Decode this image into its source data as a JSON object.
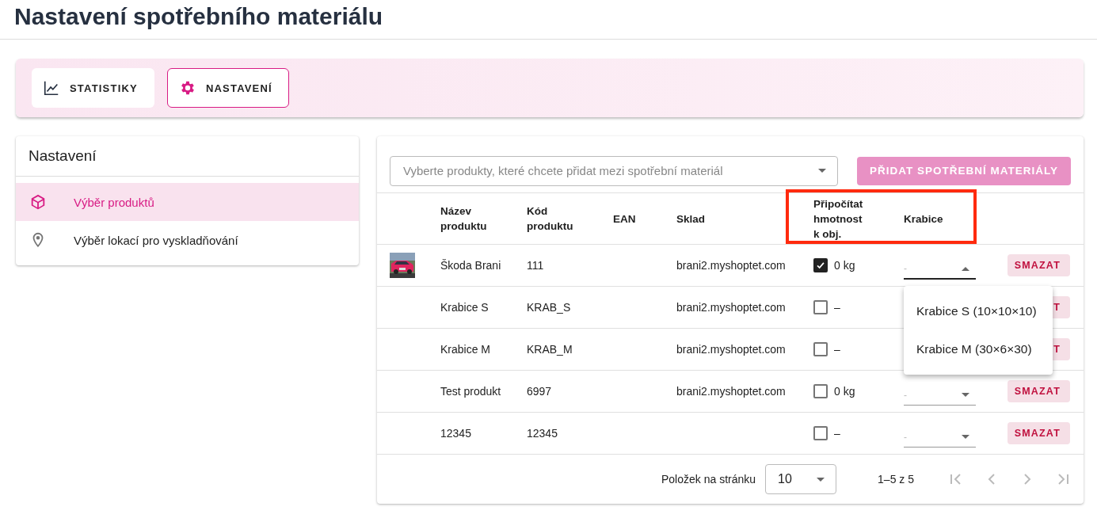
{
  "page_title": "Nastavení spotřebního materiálu",
  "tabs": [
    {
      "label": "STATISTIKY",
      "selected": false
    },
    {
      "label": "NASTAVENÍ",
      "selected": true
    }
  ],
  "sidebar": {
    "title": "Nastavení",
    "items": [
      {
        "label": "Výběr produktů",
        "selected": true
      },
      {
        "label": "Výběr lokací pro vyskladňování",
        "selected": false
      }
    ]
  },
  "product_picker": {
    "placeholder": "Vyberte produkty, které chcete přidat mezi spotřební materiál",
    "button": "PŘIDAT SPOTŘEBNÍ MATERIÁLY"
  },
  "table": {
    "columns": [
      "Název produktu",
      "Kód produktu",
      "EAN",
      "Sklad",
      "Připočítat hmotnost k obj.",
      "Krabice"
    ],
    "highlight": {
      "color": "#ff2a0e"
    },
    "rows": [
      {
        "has_picture": true,
        "name": "Škoda Brani",
        "code": "111",
        "warehouse": "brani2.myshoptet.com",
        "weight": {
          "checked": true,
          "text": "0 kg"
        },
        "box": {
          "value": "-",
          "open": true,
          "options": [
            "Krabice S (10×10×10)",
            "Krabice M (30×6×30)"
          ]
        },
        "delete": "SMAZAT"
      },
      {
        "has_picture": false,
        "name": "Krabice S",
        "code": "KRAB_S",
        "warehouse": "brani2.myshoptet.com",
        "weight": {
          "checked": false,
          "text": "–"
        },
        "delete": "T"
      },
      {
        "has_picture": false,
        "name": "Krabice M",
        "code": "KRAB_M",
        "warehouse": "brani2.myshoptet.com",
        "weight": {
          "checked": false,
          "text": "–"
        },
        "delete": "T"
      },
      {
        "has_picture": false,
        "name": "Test produkt",
        "code": "6997",
        "warehouse": "brani2.myshoptet.com",
        "weight": {
          "checked": false,
          "text": "0 kg"
        },
        "box": {
          "value": "-",
          "open": false
        },
        "delete": "SMAZAT"
      },
      {
        "has_picture": false,
        "name": "12345",
        "code": "12345",
        "weight": {
          "checked": false,
          "text": "–"
        },
        "box": {
          "value": "-",
          "open": false
        },
        "delete": "SMAZAT"
      }
    ]
  },
  "footer": {
    "rows_per_page_label": "Položek na stránku",
    "rows_per_page": "10",
    "range": "1–5 z 5"
  }
}
